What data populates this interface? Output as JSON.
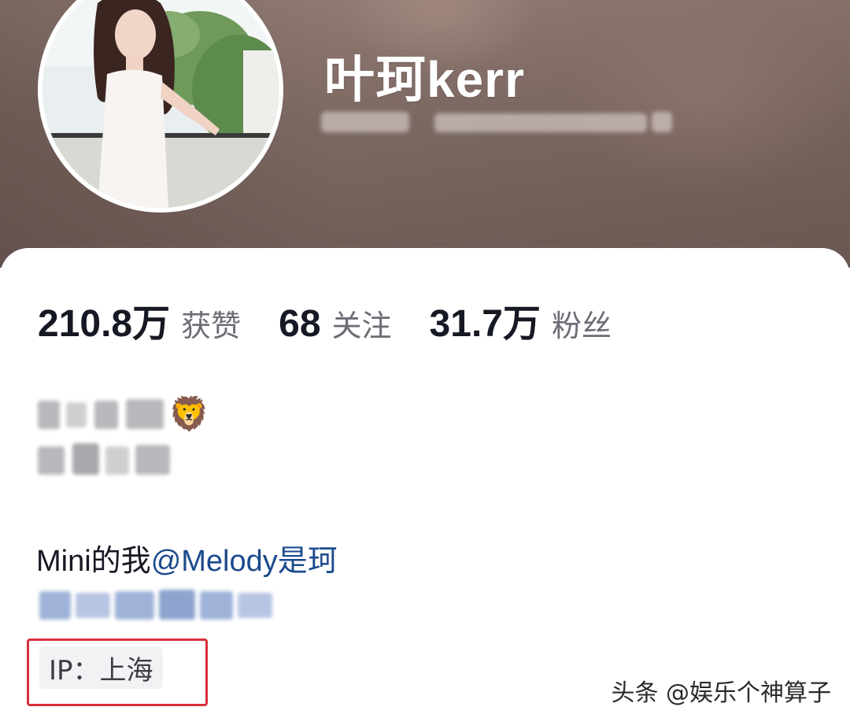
{
  "profile": {
    "username": "叶珂kerr",
    "account_id_redacted": true
  },
  "stats": [
    {
      "value": "210.8万",
      "label": "获赞"
    },
    {
      "value": "68",
      "label": "关注"
    },
    {
      "value": "31.7万",
      "label": "粉丝"
    }
  ],
  "bio": {
    "emoji": "🦁",
    "mention_prefix": "Mini的我",
    "mention": "@Melody是珂"
  },
  "ip": {
    "label": "IP：上海"
  },
  "watermark": "头条 @娱乐个神算子",
  "colors": {
    "mention": "#1b4a8c",
    "highlight_box": "#d8303a"
  }
}
